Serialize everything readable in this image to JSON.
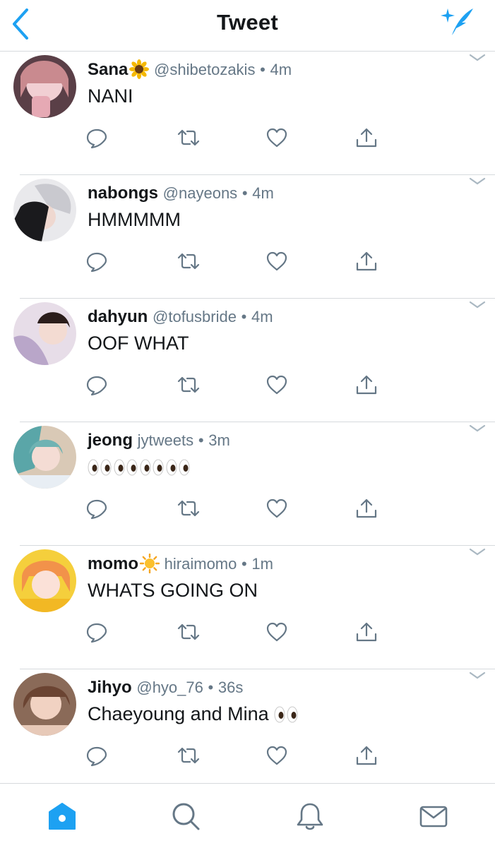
{
  "header": {
    "title": "Tweet"
  },
  "tweets": [
    {
      "name": "Sana",
      "name_emoji": "sunflower",
      "handle": "@shibetozakis",
      "dot": "•",
      "time": "4m",
      "text": "NANI",
      "avatar_color": "#d9a7b4"
    },
    {
      "name": "nabongs",
      "name_emoji": "",
      "handle": "@nayeons",
      "dot": "•",
      "time": "4m",
      "text": "HMMMMM",
      "avatar_color": "#b9b9bd"
    },
    {
      "name": "dahyun",
      "name_emoji": "",
      "handle": "@tofusbride",
      "dot": "•",
      "time": "4m",
      "text": "OOF WHAT",
      "avatar_color": "#cdb8c8"
    },
    {
      "name": "jeong",
      "name_emoji": "",
      "handle": "jytweets",
      "dot": "•",
      "time": "3m",
      "text": "",
      "text_emoji": "eyes x4",
      "avatar_color": "#7fb7b4"
    },
    {
      "name": "momo",
      "name_emoji": "sun",
      "handle": "hiraimomo",
      "dot": "•",
      "time": "1m",
      "text": "WHATS GOING ON",
      "avatar_color": "#f2c23a"
    },
    {
      "name": "Jihyo",
      "name_emoji": "",
      "handle": "@hyo_76",
      "dot": "•",
      "time": "36s",
      "text": "Chaeyoung and Mina",
      "text_emoji": "eyes x1",
      "avatar_color": "#c59c82"
    }
  ],
  "colors": {
    "accent": "#1da1f2",
    "icon_gray": "#657786",
    "divider": "#d6dadd"
  },
  "icons": {
    "header": [
      "back-chevron-icon",
      "compose-sparkle-quill-icon"
    ],
    "actions": [
      "reply-icon",
      "retweet-icon",
      "like-icon",
      "share-icon"
    ],
    "tabbar": [
      "home-icon",
      "search-icon",
      "notifications-icon",
      "messages-icon"
    ]
  }
}
